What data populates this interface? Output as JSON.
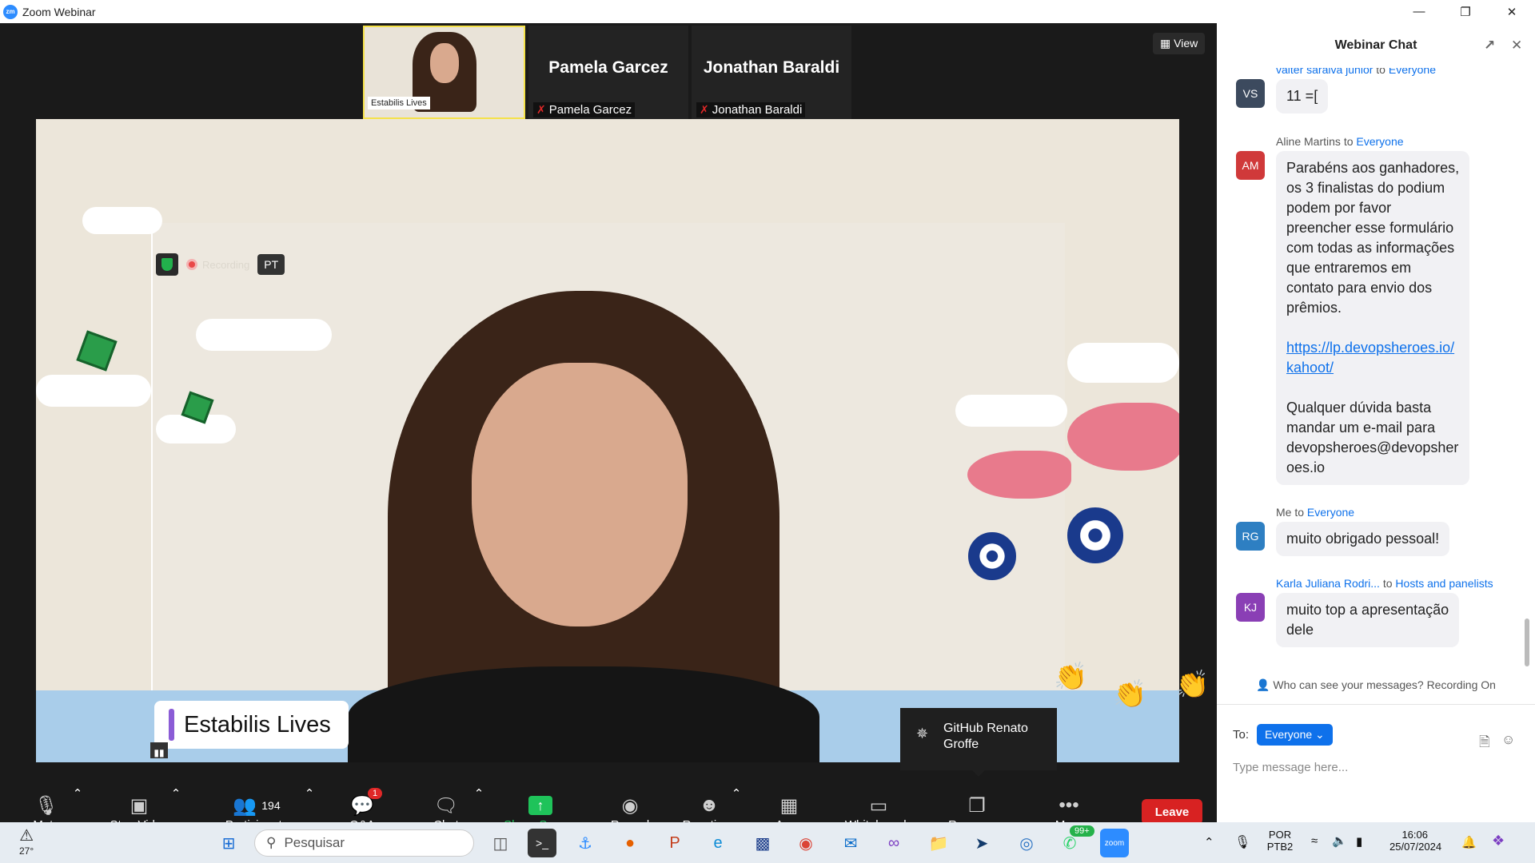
{
  "window": {
    "title": "Zoom Webinar",
    "controls": [
      "minimize-icon",
      "restore-icon",
      "close-icon"
    ]
  },
  "filmstrip": [
    {
      "kind": "video",
      "label": "Estabilis Lives"
    },
    {
      "kind": "name",
      "big": "Pamela Garcez",
      "small": "Pamela Garcez",
      "muted": true
    },
    {
      "kind": "name",
      "big": "Jonathan Baraldi",
      "small": "Jonathan Baraldi",
      "muted": true
    }
  ],
  "view_button": "View",
  "stage": {
    "recording": "Recording",
    "language_badge": "PT",
    "name_tag": "Estabilis Lives",
    "tooltip": "GitHub Renato Groffe"
  },
  "toolbar": {
    "mute": "Mute",
    "stop_video": "Stop Video",
    "participants": "Participants",
    "participants_count": "194",
    "qa": "Q&A",
    "qa_badge": "1",
    "chat": "Chat",
    "share_screen": "Share Screen",
    "record": "Record",
    "reactions": "Reactions",
    "apps": "Apps",
    "whiteboards": "Whiteboards",
    "resources": "Resources",
    "more": "More",
    "leave": "Leave"
  },
  "chat": {
    "title": "Webinar Chat",
    "messages": [
      {
        "sender": "valter saraiva junior",
        "to_word": "to",
        "recipient": "Everyone",
        "initials": "VS",
        "avatar_color": "#3c4a5e",
        "text": "11 =["
      },
      {
        "sender": "Aline Martins",
        "to_word": "to",
        "recipient": "Everyone",
        "initials": "AM",
        "avatar_color": "#d0393a",
        "text_lines": [
          "Parabéns aos ganhadores,",
          "os 3 finalistas do podium",
          "podem por favor",
          "preencher esse formulário",
          "com todas as informações",
          "que entraremos em",
          "contato para envio dos",
          "prêmios."
        ],
        "link_lines": [
          "https://lp.devopsheroes.io/",
          "kahoot/"
        ],
        "tail_lines": [
          "Qualquer dúvida basta",
          "mandar um e-mail para",
          "devopsheroes@devopsher",
          "oes.io"
        ]
      },
      {
        "sender": "Me",
        "to_word": "to",
        "recipient": "Everyone",
        "initials": "RG",
        "avatar_color": "#2e7fc2",
        "text": "muito obrigado pessoal!"
      },
      {
        "sender": "Karla Juliana Rodri...",
        "to_word": "to",
        "recipient": "Hosts and panelists",
        "initials": "KJ",
        "avatar_color": "#8a3fb5",
        "text_lines": [
          "muito top a apresentação",
          "dele"
        ]
      }
    ],
    "privacy_note": "Who can see your messages? Recording On",
    "to_label": "To:",
    "to_value": "Everyone",
    "placeholder": "Type message here..."
  },
  "taskbar": {
    "temperature": "27°",
    "search_placeholder": "Pesquisar",
    "whatsapp_badge": "99+",
    "lang_top": "POR",
    "lang_bottom": "PTB2",
    "time": "16:06",
    "date": "25/07/2024"
  }
}
